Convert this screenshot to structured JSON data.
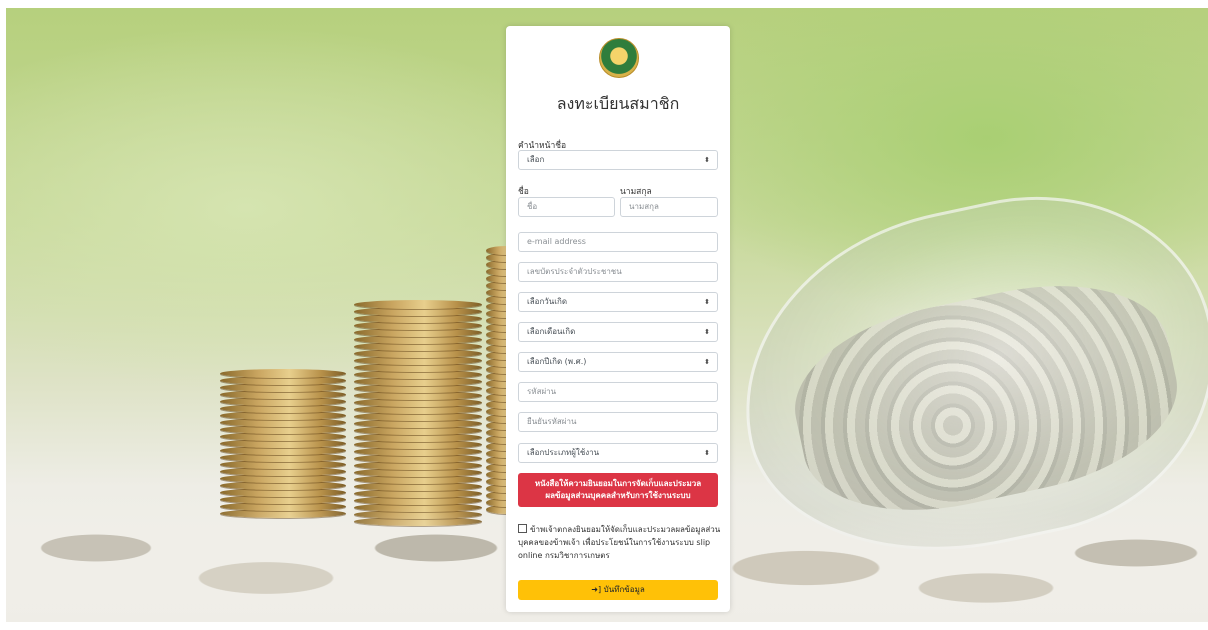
{
  "form": {
    "title": "ลงทะเบียนสมาชิก",
    "title_label": "คำนำหน้าชื่อ",
    "title_select": "เลือก",
    "firstname_label": "ชื่อ",
    "firstname_placeholder": "ชื่อ",
    "lastname_label": "นามสกุล",
    "lastname_placeholder": "นามสกุล",
    "email_placeholder": "e-mail address",
    "idcard_placeholder": "เลขบัตรประจำตัวประชาชน",
    "birth_day_select": "เลือกวันเกิด",
    "birth_month_select": "เลือกเดือนเกิด",
    "birth_year_select": "เลือกปีเกิด (พ.ศ.)",
    "password_placeholder": "รหัสผ่าน",
    "confirm_password_placeholder": "ยืนยันรหัสผ่าน",
    "user_type_select": "เลือกประเภทผู้ใช้งาน",
    "consent_button_line1": "หนังสือให้ความยินยอมในการจัดเก็บและประมวล",
    "consent_button_line2": "ผลข้อมูลส่วนบุคคลสำหรับการใช้งานระบบ",
    "consent_text": "ข้าพเจ้าตกลงยินยอมให้จัดเก็บและประมวลผลข้อมูลส่วนบุคคลของข้าพเจ้า เพื่อประโยชน์ในการใช้งานระบบ slip online กรมวิชาการเกษตร",
    "save_button": "บันทึกข้อมูล"
  },
  "colors": {
    "consent_button": "#dc3545",
    "save_button": "#ffc107"
  },
  "icons": {
    "logo": "department-seal",
    "select_caret": "up-down-caret",
    "save": "sign-in-icon"
  }
}
